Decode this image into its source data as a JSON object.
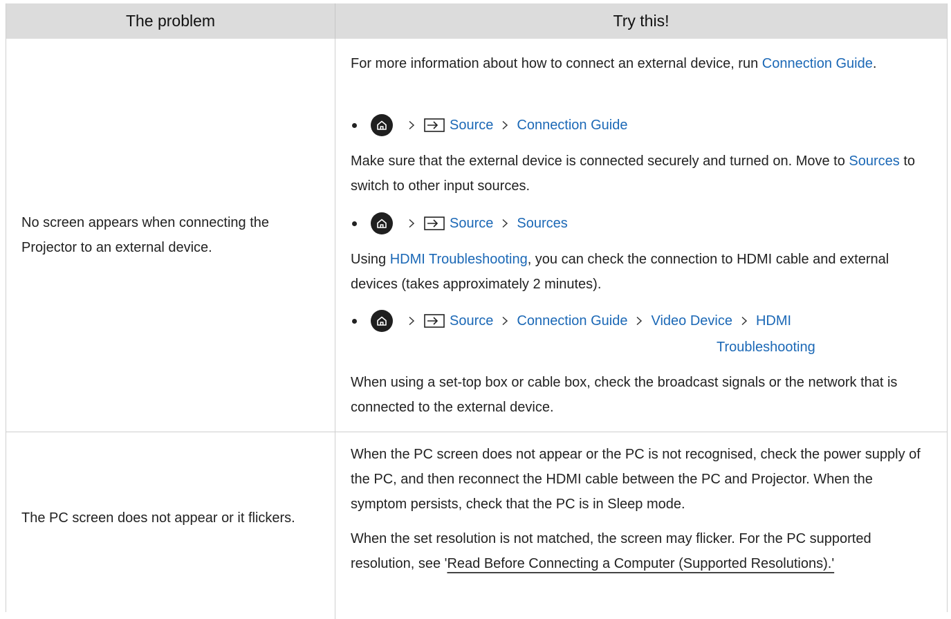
{
  "header": {
    "col1": "The problem",
    "col2": "Try this!"
  },
  "rows": [
    {
      "problem": "No screen appears when connecting the Projector to an external device.",
      "p1_text": "For more information about how to connect an external device, run ",
      "p1_link": "Connection Guide",
      "p1_end": ".",
      "path1": [
        "Source",
        "Connection Guide"
      ],
      "p2_text": "Make sure that the external device is connected securely and turned on. Move to ",
      "p2_link": "Sources",
      "p2_end": " to switch to other input sources.",
      "path2": [
        "Source",
        "Sources"
      ],
      "p3_start": "Using ",
      "p3_link": "HDMI Troubleshooting",
      "p3_end": ", you can check the connection to HDMI cable and external devices (takes approximately 2 minutes).",
      "path3": [
        "Source",
        "Connection Guide",
        "Video Device",
        "HDMI",
        "Troubleshooting"
      ],
      "p4_text": "When using a set-top box or cable box, check the broadcast signals or the network that is connected to the external device."
    },
    {
      "problem": "The PC screen does not appear or it flickers.",
      "p1_text": "When the PC screen does not appear or the PC is not recognised, check the power supply of the PC, and then reconnect the HDMI cable between the PC and Projector. When the symptom persists, check that the PC is in Sleep mode.",
      "p2_start": "When the set resolution is not matched, the screen may flicker. For the PC supported resolution, see '",
      "p2_ref": "Read Before Connecting a Computer (Supported Resolutions).'"
    }
  ],
  "icons": {
    "home": "home-icon",
    "source": "source-input-icon",
    "chevron": "chevron-right-icon"
  },
  "colors": {
    "link": "#1b68b6",
    "header_bg": "#dcdcdc"
  }
}
